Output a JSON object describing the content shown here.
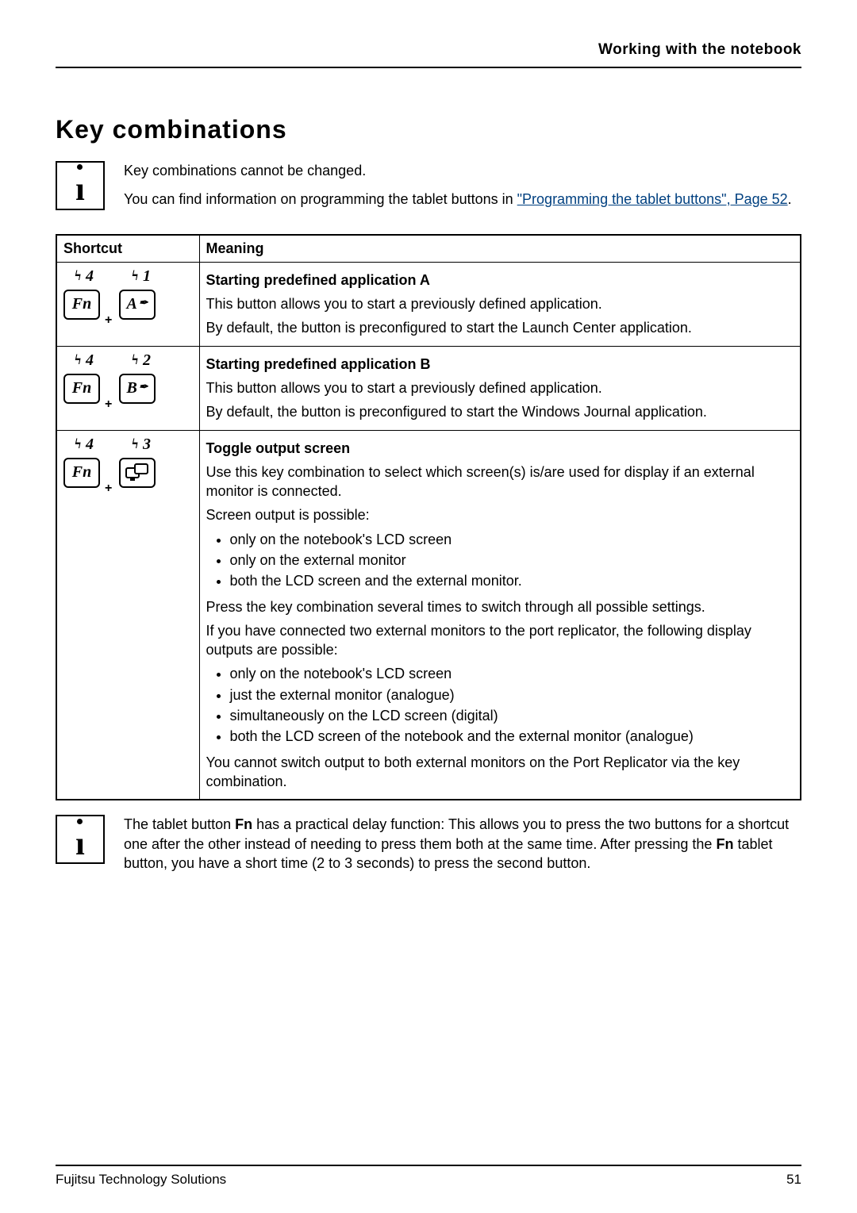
{
  "header": {
    "section_title": "Working with the notebook"
  },
  "section": {
    "heading": "Key combinations",
    "intro1": "Key combinations cannot be changed.",
    "intro2a": "You can find information on programming the tablet buttons in ",
    "intro2_link": "\"Programming the tablet buttons\", Page 52",
    "intro2b": "."
  },
  "table_headers": {
    "shortcut": "Shortcut",
    "meaning": "Meaning"
  },
  "rows": [
    {
      "tap1": "4",
      "tap2": "1",
      "key1": "Fn",
      "key2": "A",
      "key2_extra": "✒",
      "title": "Starting predefined application A",
      "p1": "This button allows you to start a previously defined application.",
      "p2": "By default, the button is preconfigured to start the Launch Center application."
    },
    {
      "tap1": "4",
      "tap2": "2",
      "key1": "Fn",
      "key2": "B",
      "key2_extra": "✒",
      "title": "Starting predefined application B",
      "p1": "This button allows you to start a previously defined application.",
      "p2": "By default, the button is preconfigured to start the Windows Journal application."
    },
    {
      "tap1": "4",
      "tap2": "3",
      "key1": "Fn",
      "key2_icon": "screens",
      "title": "Toggle output screen",
      "p1": "Use this key combination to select which screen(s) is/are used for display if an external monitor is connected.",
      "p2": "Screen output is possible:",
      "list1": [
        "only on the notebook's LCD screen",
        "only on the external monitor",
        "both the LCD screen and the external monitor."
      ],
      "p3": "Press the key combination several times to switch through all possible settings.",
      "p4": "If you have connected two external monitors to the port replicator, the following display outputs are possible:",
      "list2": [
        "only on the notebook's LCD screen",
        "just the external monitor (analogue)",
        "simultaneously on the LCD screen (digital)",
        "both the LCD screen of the notebook and the external monitor (analogue)"
      ],
      "p5": "You cannot switch output to both external monitors on the Port Replicator via the key combination."
    }
  ],
  "note": {
    "t1": "The tablet button ",
    "b1": "Fn",
    "t2": " has a practical delay function: This allows you to press the two buttons for a shortcut one after the other instead of needing to press them both at the same time. After pressing the ",
    "b2": "Fn",
    "t3": " tablet button, you have a short time (2 to 3 seconds) to press the second button."
  },
  "footer": {
    "left": "Fujitsu Technology Solutions",
    "right": "51"
  }
}
